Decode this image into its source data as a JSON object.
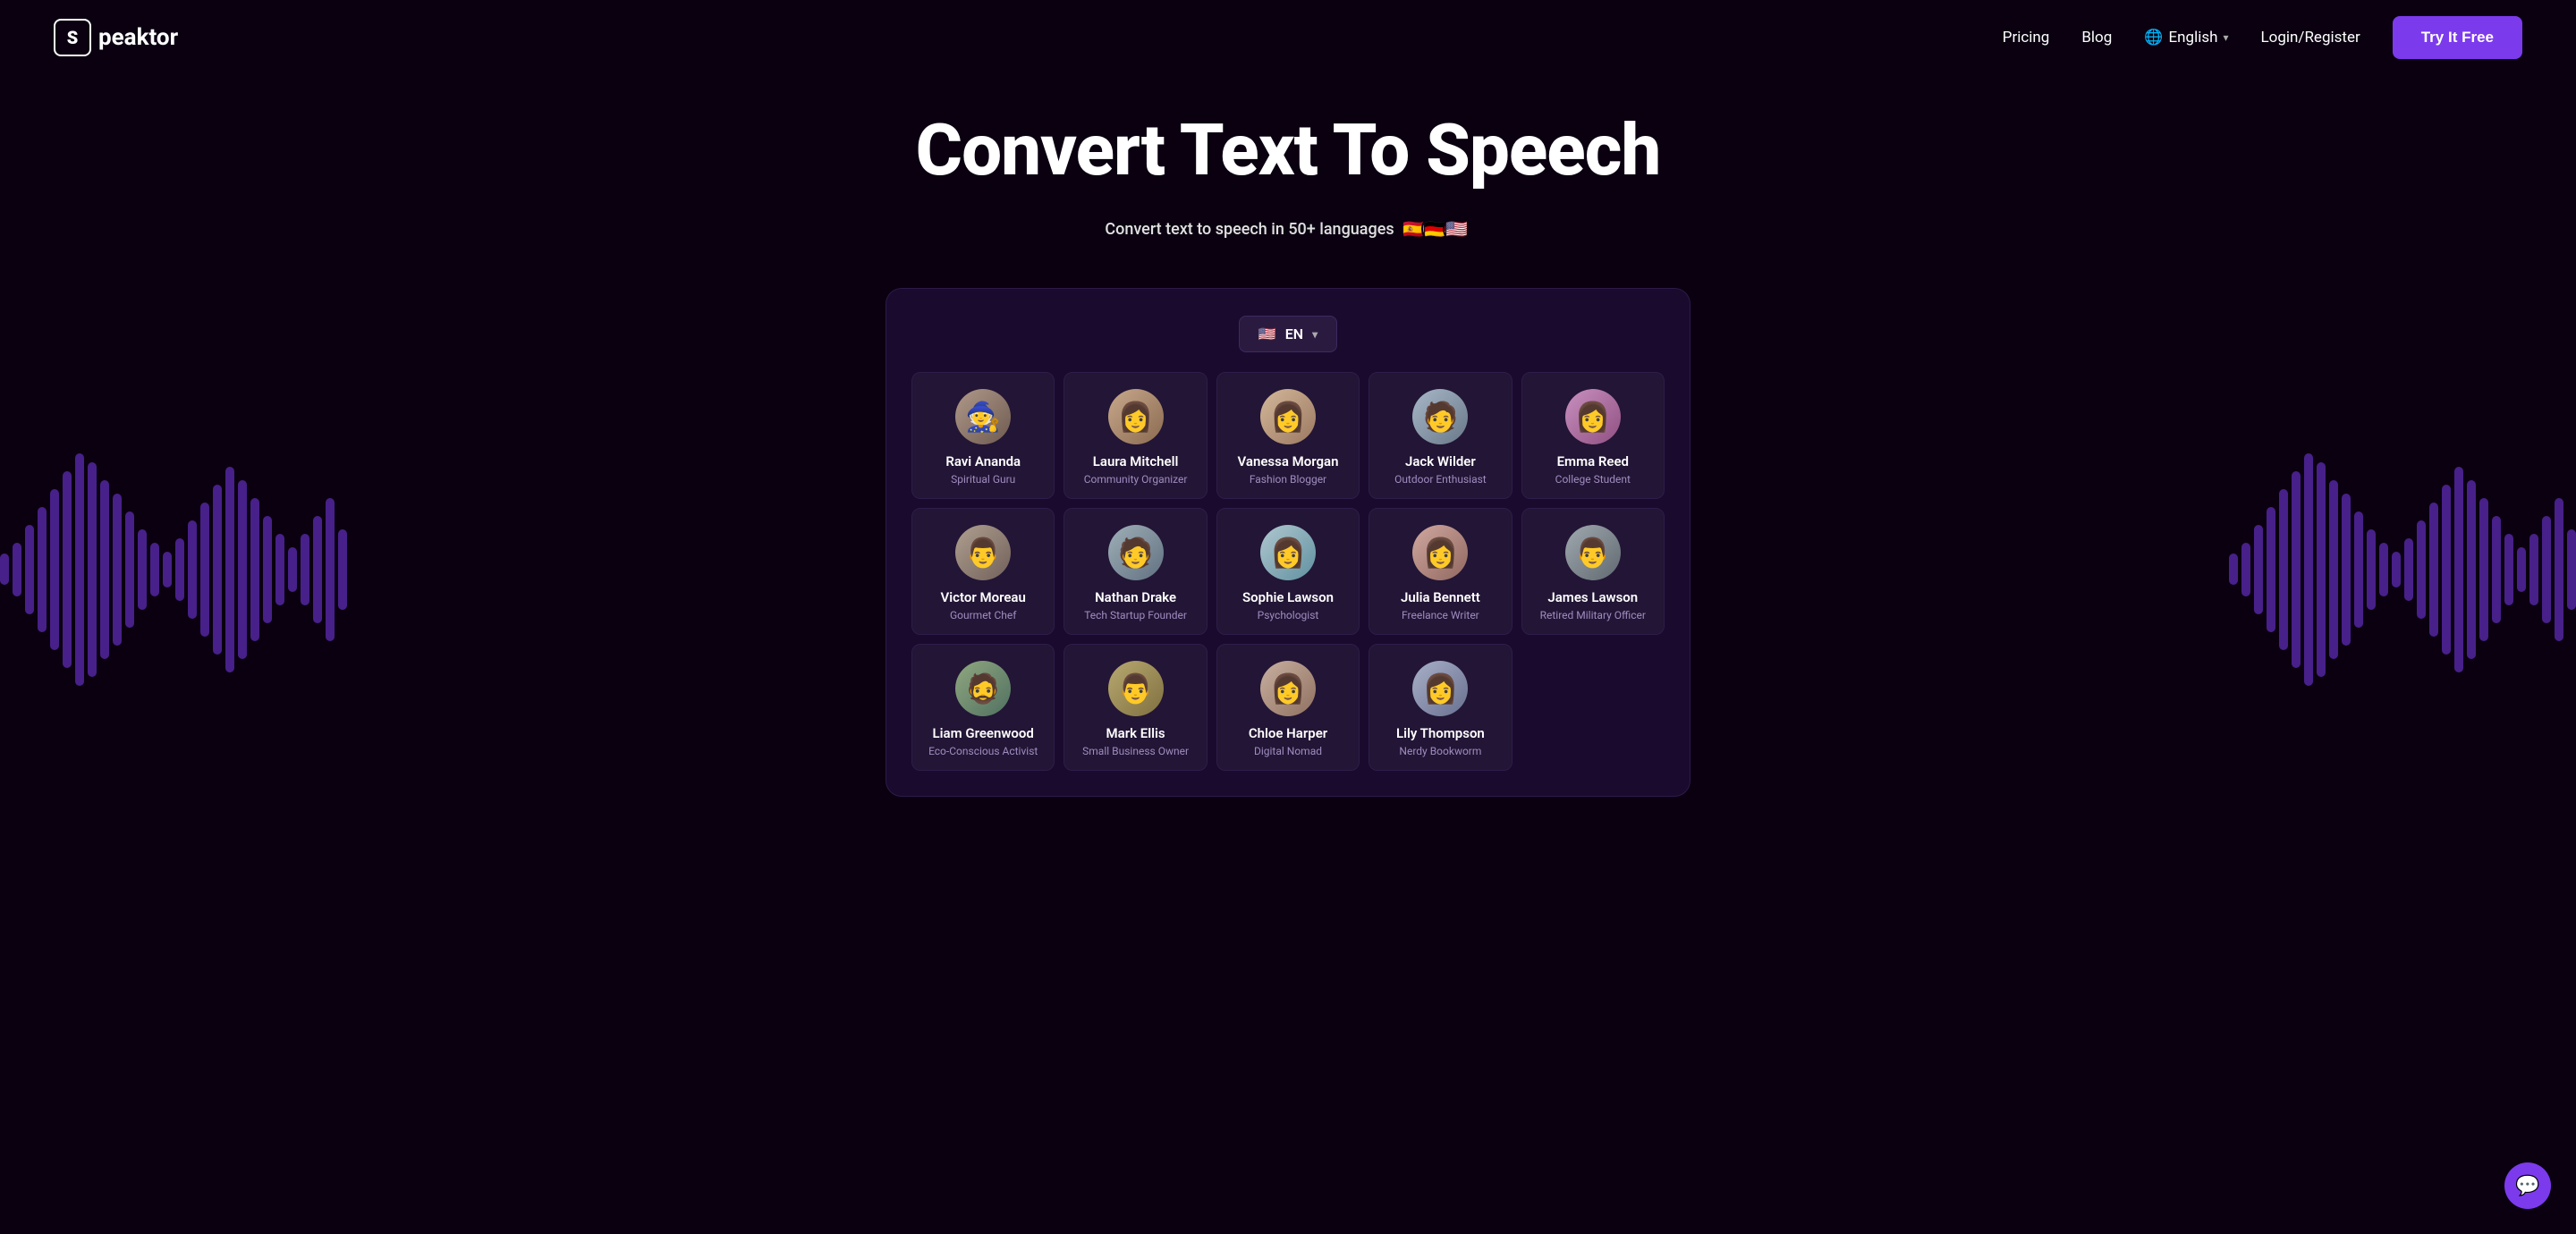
{
  "nav": {
    "logo_letter": "S",
    "logo_name": "peaktor",
    "pricing_label": "Pricing",
    "blog_label": "Blog",
    "lang_label": "English",
    "login_label": "Login/Register",
    "try_label": "Try It Free"
  },
  "hero": {
    "title": "Convert Text To Speech",
    "subtitle": "Convert text to speech in 50+ languages",
    "flags": [
      "🇪🇸",
      "🇩🇪",
      "🇺🇸"
    ]
  },
  "panel": {
    "lang_code": "EN",
    "voices": [
      {
        "id": "ravi",
        "name": "Ravi Ananda",
        "role": "Spiritual Guru",
        "avatar_class": "av-ravi",
        "icon": "🧙"
      },
      {
        "id": "laura",
        "name": "Laura Mitchell",
        "role": "Community Organizer",
        "avatar_class": "av-laura",
        "icon": "👩"
      },
      {
        "id": "vanessa",
        "name": "Vanessa Morgan",
        "role": "Fashion Blogger",
        "avatar_class": "av-vanessa",
        "icon": "👩"
      },
      {
        "id": "jack",
        "name": "Jack Wilder",
        "role": "Outdoor Enthusiast",
        "avatar_class": "av-jack",
        "icon": "🧑"
      },
      {
        "id": "emma",
        "name": "Emma Reed",
        "role": "College Student",
        "avatar_class": "av-emma",
        "icon": "👩"
      },
      {
        "id": "victor",
        "name": "Victor Moreau",
        "role": "Gourmet Chef",
        "avatar_class": "av-victor",
        "icon": "👨"
      },
      {
        "id": "nathan",
        "name": "Nathan Drake",
        "role": "Tech Startup Founder",
        "avatar_class": "av-nathan",
        "icon": "🧑"
      },
      {
        "id": "sophie",
        "name": "Sophie Lawson",
        "role": "Psychologist",
        "avatar_class": "av-sophie",
        "icon": "👩"
      },
      {
        "id": "julia",
        "name": "Julia Bennett",
        "role": "Freelance Writer",
        "avatar_class": "av-julia",
        "icon": "👩"
      },
      {
        "id": "james",
        "name": "James Lawson",
        "role": "Retired Military Officer",
        "avatar_class": "av-james",
        "icon": "👨"
      },
      {
        "id": "liam",
        "name": "Liam Greenwood",
        "role": "Eco-Conscious Activist",
        "avatar_class": "av-liam",
        "icon": "🧔"
      },
      {
        "id": "mark",
        "name": "Mark Ellis",
        "role": "Small Business Owner",
        "avatar_class": "av-mark",
        "icon": "👨"
      },
      {
        "id": "chloe",
        "name": "Chloe Harper",
        "role": "Digital Nomad",
        "avatar_class": "av-chloe",
        "icon": "👩"
      },
      {
        "id": "lily",
        "name": "Lily Thompson",
        "role": "Nerdy Bookworm",
        "avatar_class": "av-lily",
        "icon": "👩"
      }
    ],
    "wave_heights_left": [
      40,
      80,
      120,
      160,
      200,
      240,
      200,
      160,
      120,
      80,
      60,
      100,
      140,
      180,
      220,
      260,
      220,
      180,
      140,
      100,
      80,
      120,
      160,
      200,
      160,
      120,
      80,
      40
    ],
    "wave_heights_right": [
      40,
      80,
      120,
      160,
      200,
      240,
      200,
      160,
      120,
      80,
      60,
      100,
      140,
      180,
      220,
      260,
      220,
      180,
      140,
      100,
      80,
      120,
      160,
      200,
      160,
      120,
      80,
      40
    ]
  },
  "chat": {
    "icon": "💬"
  }
}
